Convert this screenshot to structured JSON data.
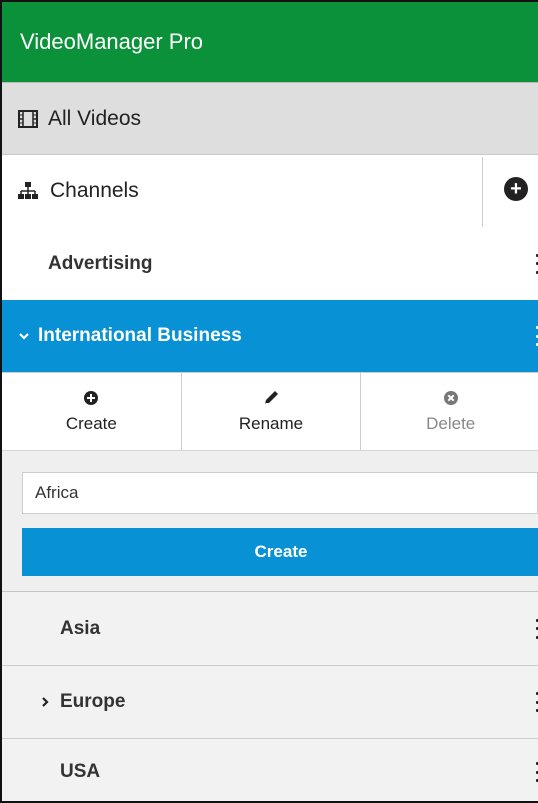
{
  "app": {
    "title": "VideoManager Pro"
  },
  "nav": {
    "all_videos": {
      "label": "All Videos",
      "icon": "film-icon"
    },
    "channels": {
      "label": "Channels",
      "icon": "sitemap-icon",
      "add_icon": "plus-circle-icon"
    }
  },
  "channels": {
    "items": [
      {
        "label": "Advertising",
        "expanded": false
      },
      {
        "label": "International Business",
        "expanded": true,
        "selected": true
      }
    ]
  },
  "actions": {
    "create": {
      "label": "Create",
      "icon": "plus-circle-icon"
    },
    "rename": {
      "label": "Rename",
      "icon": "pencil-icon"
    },
    "delete": {
      "label": "Delete",
      "icon": "times-circle-icon",
      "disabled": true
    }
  },
  "create_form": {
    "input_value": "Africa",
    "button_label": "Create"
  },
  "subchannels": [
    {
      "label": "Asia"
    },
    {
      "label": "Europe",
      "has_children": true
    },
    {
      "label": "USA"
    }
  ],
  "colors": {
    "header_bg": "#0a9139",
    "accent": "#0891d4",
    "nav_bg": "#dedede"
  }
}
